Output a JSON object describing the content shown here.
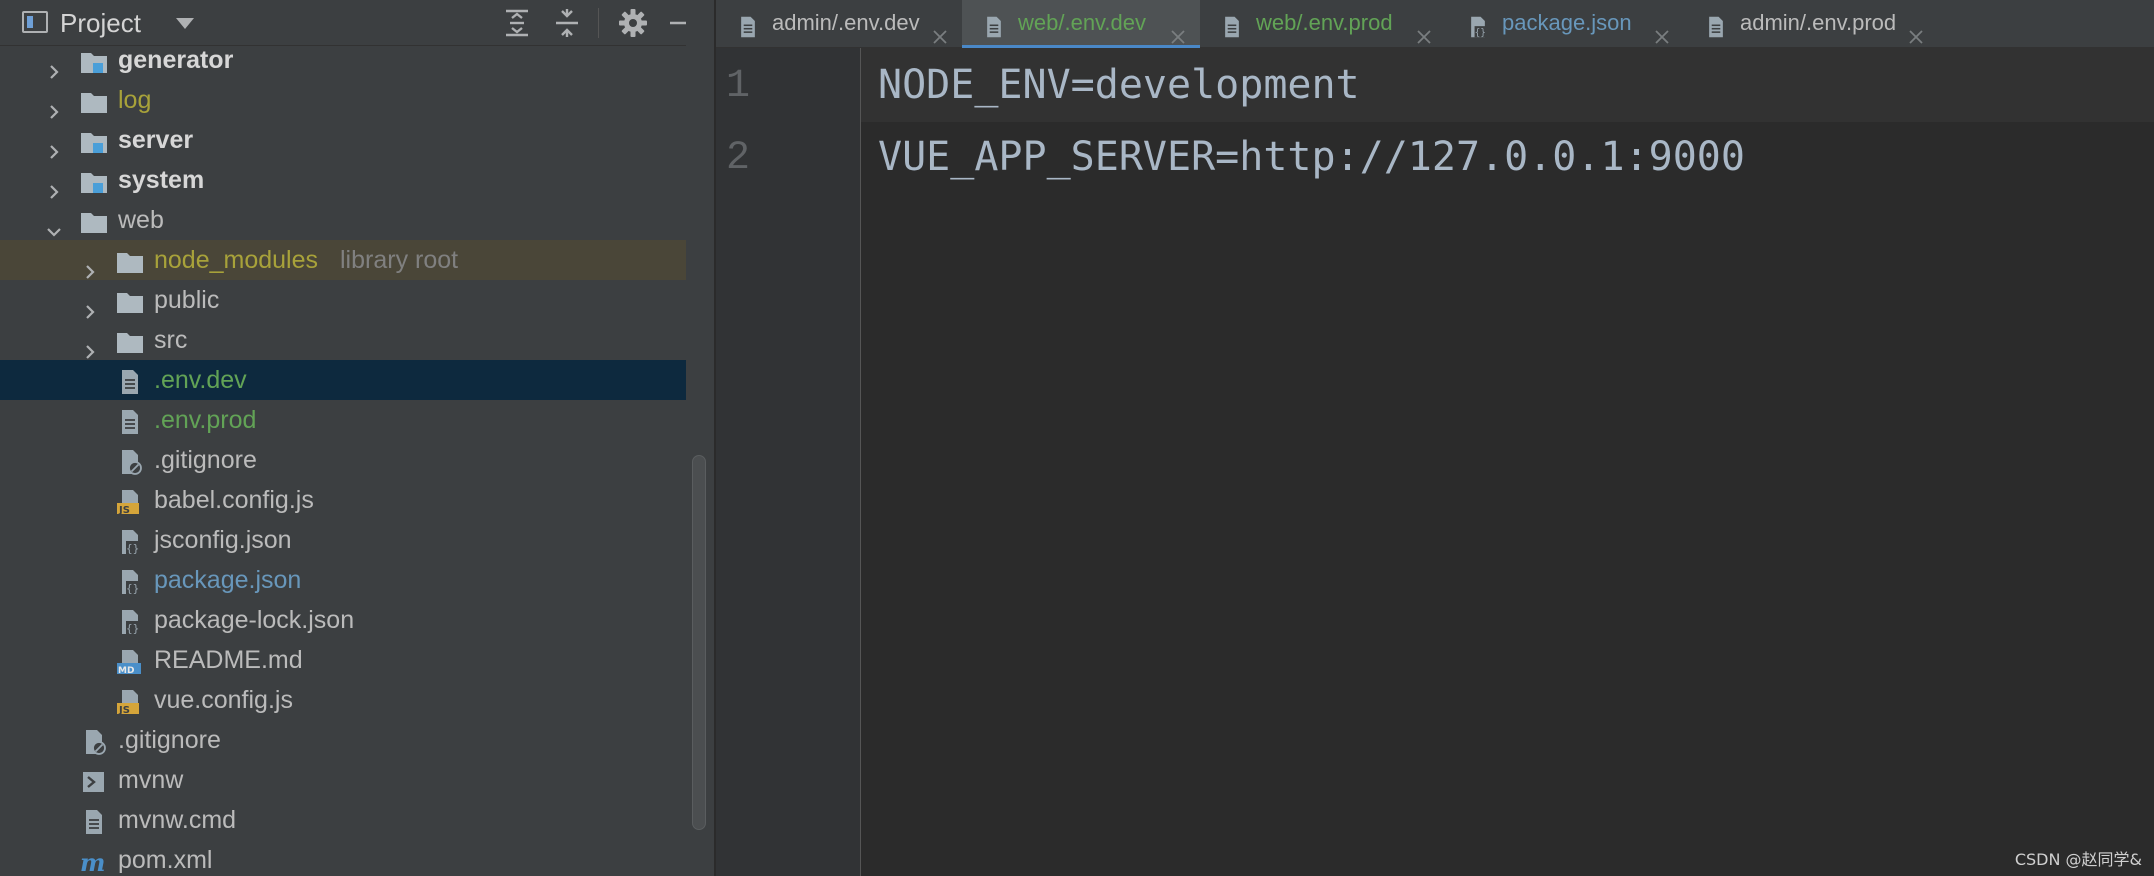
{
  "project_panel": {
    "title": "Project",
    "tree": [
      {
        "label": "generator",
        "style": "bold",
        "kind": "module",
        "depth": 1,
        "expanded": false
      },
      {
        "label": "log",
        "style": "olive",
        "kind": "folder",
        "depth": 1,
        "expanded": false
      },
      {
        "label": "server",
        "style": "bold",
        "kind": "module",
        "depth": 1,
        "expanded": false
      },
      {
        "label": "system",
        "style": "bold",
        "kind": "module",
        "depth": 1,
        "expanded": false
      },
      {
        "label": "web",
        "style": "default",
        "kind": "folder",
        "depth": 1,
        "expanded": true
      },
      {
        "label": "node_modules",
        "suffix": "library root",
        "style": "olive",
        "kind": "folder",
        "depth": 2,
        "expanded": false,
        "highlight": true
      },
      {
        "label": "public",
        "style": "default",
        "kind": "folder",
        "depth": 2,
        "expanded": false
      },
      {
        "label": "src",
        "style": "default",
        "kind": "folder",
        "depth": 2,
        "expanded": false
      },
      {
        "label": ".env.dev",
        "style": "green",
        "kind": "text-file",
        "depth": 2,
        "selected": true
      },
      {
        "label": ".env.prod",
        "style": "green",
        "kind": "text-file",
        "depth": 2
      },
      {
        "label": ".gitignore",
        "style": "default",
        "kind": "ignore-file",
        "depth": 2
      },
      {
        "label": "babel.config.js",
        "style": "default",
        "kind": "js-file",
        "depth": 2
      },
      {
        "label": "jsconfig.json",
        "style": "default",
        "kind": "json-file",
        "depth": 2
      },
      {
        "label": "package.json",
        "style": "blue",
        "kind": "json-file",
        "depth": 2
      },
      {
        "label": "package-lock.json",
        "style": "default",
        "kind": "json-file",
        "depth": 2
      },
      {
        "label": "README.md",
        "style": "default",
        "kind": "md-file",
        "depth": 2
      },
      {
        "label": "vue.config.js",
        "style": "default",
        "kind": "js-file",
        "depth": 2
      },
      {
        "label": ".gitignore",
        "style": "default",
        "kind": "ignore-file",
        "depth": 1
      },
      {
        "label": "mvnw",
        "style": "default",
        "kind": "shell-file",
        "depth": 1
      },
      {
        "label": "mvnw.cmd",
        "style": "default",
        "kind": "text-file",
        "depth": 1
      },
      {
        "label": "pom.xml",
        "style": "default",
        "kind": "maven-file",
        "depth": 1
      }
    ]
  },
  "tabs": [
    {
      "label": "admin/.env.dev",
      "style": "default",
      "kind": "text-file",
      "active": false
    },
    {
      "label": "web/.env.dev",
      "style": "green",
      "kind": "text-file",
      "active": true
    },
    {
      "label": "web/.env.prod",
      "style": "green",
      "kind": "text-file",
      "active": false
    },
    {
      "label": "package.json",
      "style": "blue",
      "kind": "json-file",
      "active": false
    },
    {
      "label": "admin/.env.prod",
      "style": "default",
      "kind": "text-file",
      "active": false
    }
  ],
  "editor": {
    "lines": [
      {
        "number": "1",
        "text": "NODE_ENV=development"
      },
      {
        "number": "2",
        "text": "VUE_APP_SERVER=http://127.0.0.1:9000"
      }
    ]
  },
  "watermark": "CSDN @赵同学&"
}
